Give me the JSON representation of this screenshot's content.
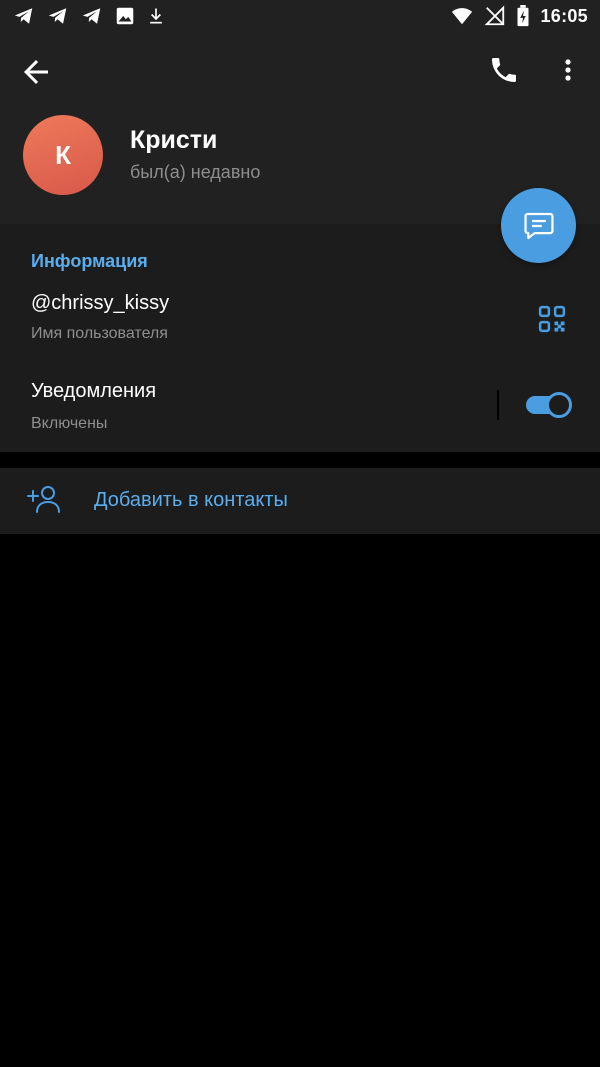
{
  "status_bar": {
    "time": "16:05",
    "left_icons": [
      "telegram-icon",
      "telegram-icon",
      "telegram-icon",
      "image-icon",
      "download-icon"
    ],
    "right_icons": [
      "wifi-icon",
      "no-signal-icon",
      "battery-charging-icon"
    ]
  },
  "header": {
    "avatar_letter": "К",
    "name": "Кристи",
    "status": "был(а) недавно"
  },
  "info": {
    "section_title": "Информация",
    "username": "@chrissy_kissy",
    "username_label": "Имя пользователя",
    "notifications_title": "Уведомления",
    "notifications_value": "Включены",
    "notifications_enabled": true
  },
  "actions": {
    "add_contact": "Добавить в контакты"
  },
  "colors": {
    "accent": "#4a9de0",
    "accent_text": "#5aaef0",
    "header_bg": "#212121",
    "section_bg": "#1c1c1c",
    "avatar_gradient": [
      "#ee7a5a",
      "#d8584a"
    ]
  }
}
